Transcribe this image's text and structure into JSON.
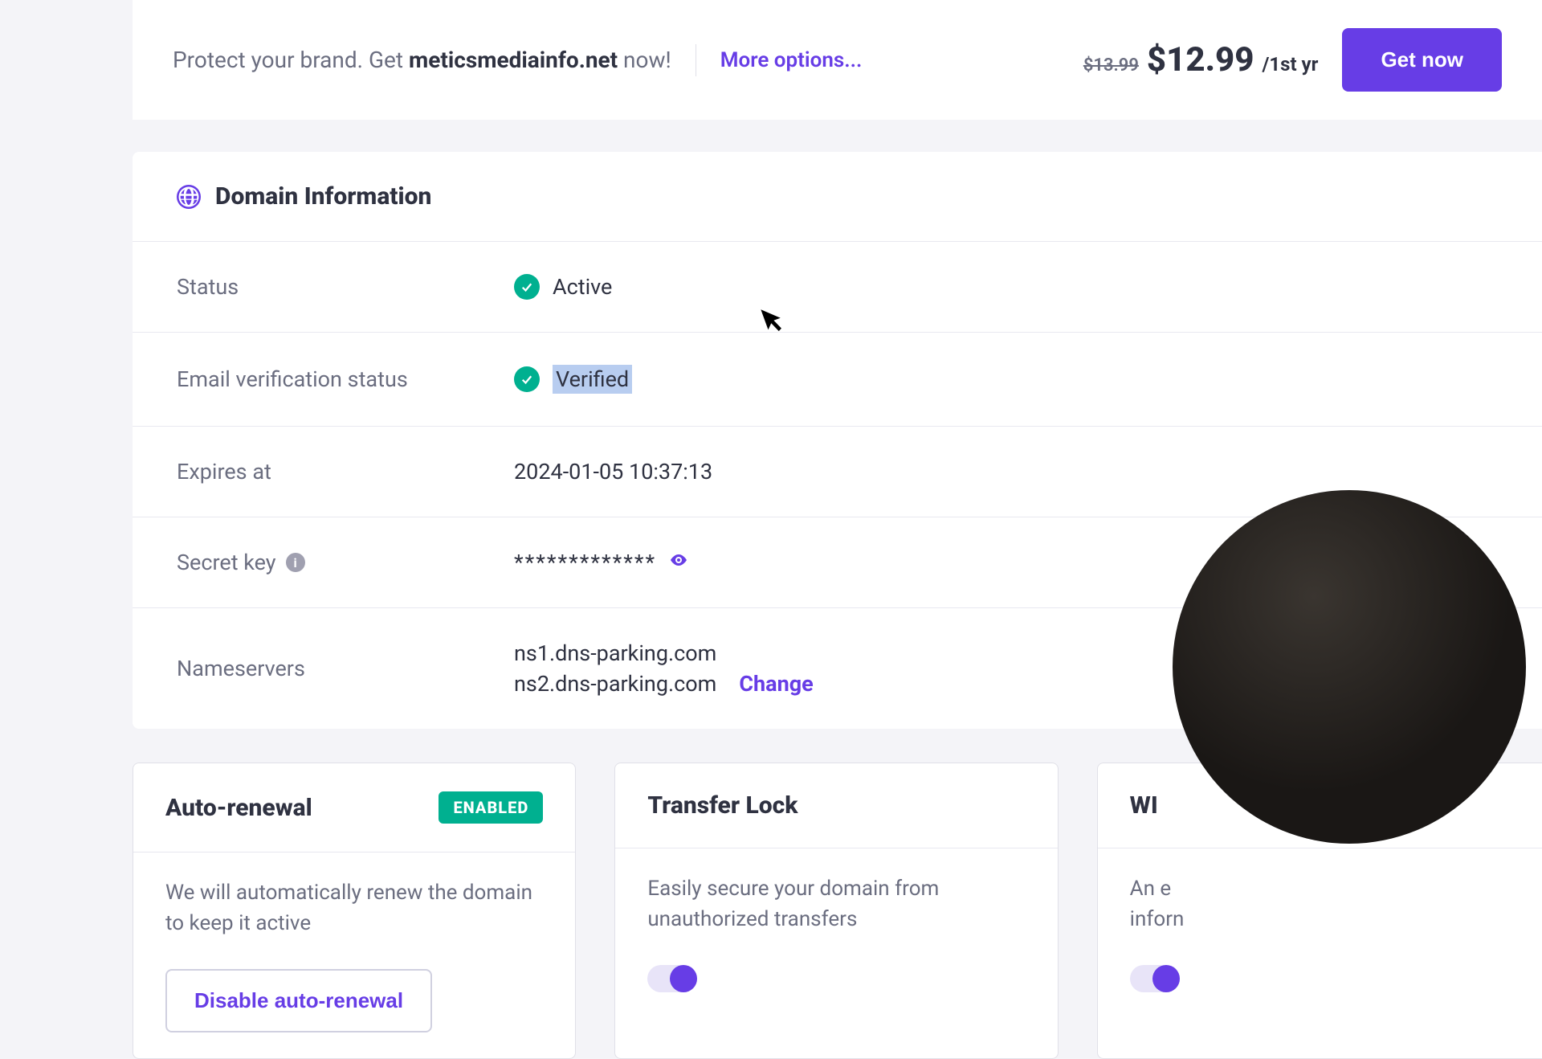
{
  "promo": {
    "text_prefix": "Protect your brand. Get ",
    "domain": "meticsmediainfo.net",
    "text_suffix": " now!",
    "more_options": "More options...",
    "old_price": "$13.99",
    "new_price": "$12.99",
    "period": "/1st yr",
    "cta": "Get now"
  },
  "domain_info": {
    "title": "Domain Information",
    "rows": {
      "status": {
        "label": "Status",
        "value": "Active"
      },
      "email_verification": {
        "label": "Email verification status",
        "value": "Verified"
      },
      "expires": {
        "label": "Expires at",
        "value": "2024-01-05 10:37:13"
      },
      "secret": {
        "label": "Secret key",
        "value": "*************"
      },
      "nameservers": {
        "label": "Nameservers",
        "ns1": "ns1.dns-parking.com",
        "ns2": "ns2.dns-parking.com",
        "change": "Change"
      }
    }
  },
  "cards": {
    "auto_renewal": {
      "title": "Auto-renewal",
      "badge": "ENABLED",
      "desc": "We will automatically renew the domain to keep it active",
      "button": "Disable auto-renewal"
    },
    "transfer_lock": {
      "title": "Transfer Lock",
      "desc": "Easily secure your domain from unauthorized transfers"
    },
    "whois": {
      "title": "WI",
      "desc_line1": "An e",
      "desc_line2": "inforn"
    }
  }
}
